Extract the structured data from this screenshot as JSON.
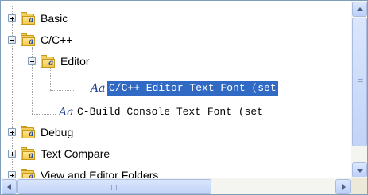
{
  "tree": {
    "categories": {
      "basic": "Basic",
      "cpp": "C/C++",
      "editor": "Editor",
      "debug": "Debug",
      "text_compare": "Text Compare",
      "view_editor_folders": "View and Editor Folders"
    },
    "items": {
      "editor_text_font": "C/C++ Editor Text Font (set",
      "build_console_font": "C-Build Console Text Font (set"
    },
    "font_glyph": "Aa",
    "selected_item": "C/C++ Editor Text Font (set"
  },
  "colors": {
    "selection": "#316ac5",
    "border": "#7f9db9"
  },
  "icons": {
    "category": "font-category-folder-icon",
    "item": "font-item-icon"
  }
}
